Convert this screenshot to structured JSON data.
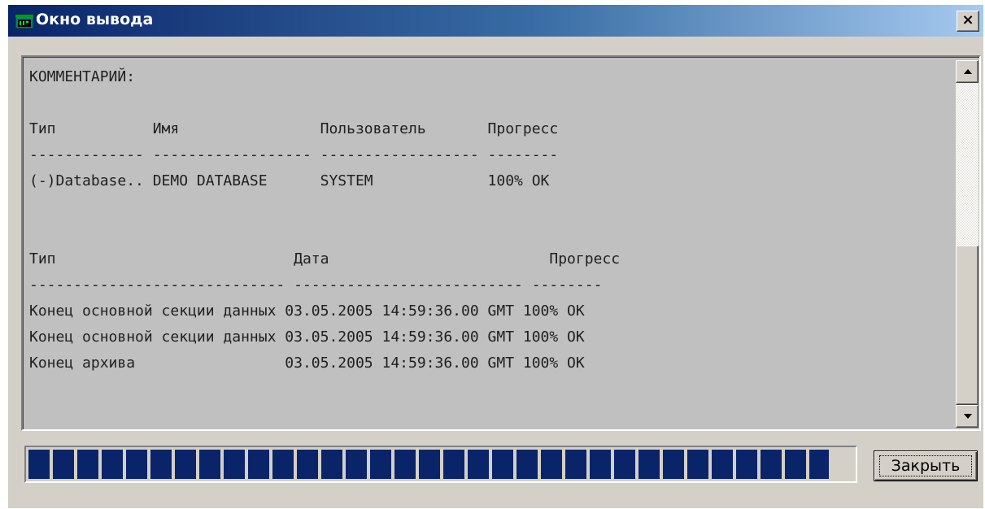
{
  "window": {
    "title": "Окно вывода",
    "close_glyph": "×",
    "icon": "terminal-icon"
  },
  "output": {
    "lines": [
      "КОММЕНТАРИЙ:",
      "",
      "Тип           Имя                Пользователь       Прогресс",
      "------------- ------------------ ------------------ --------",
      "(-)Database.. DEMO DATABASE      SYSTEM             100% OK",
      "",
      "",
      "Тип                           Дата                         Прогресс",
      "----------------------------- -------------------------- --------",
      "Конец основной секции данных 03.05.2005 14:59:36.00 GMT 100% OK",
      "Конец основной секции данных 03.05.2005 14:59:36.00 GMT 100% OK",
      "Конец архива                 03.05.2005 14:59:36.00 GMT 100% OK"
    ]
  },
  "progress": {
    "value": 1.0,
    "color": "#0a246a"
  },
  "buttons": {
    "close_label": "Закрыть"
  },
  "colors": {
    "face": "#d4d0c8",
    "text_area_bg": "#c0c0c0",
    "title_start": "#0a246a",
    "title_end": "#a6caf0"
  }
}
